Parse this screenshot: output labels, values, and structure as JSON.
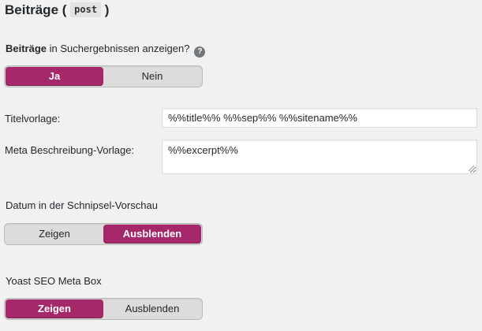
{
  "section": {
    "title": "Beiträge (",
    "code": "post",
    "title_end": ")"
  },
  "search_visibility": {
    "label_bold": "Beiträge",
    "label_rest": " in Suchergebnissen anzeigen?",
    "help_icon": "?",
    "options": [
      "Ja",
      "Nein"
    ],
    "selected": "Ja"
  },
  "title_template": {
    "label": "Titelvorlage:",
    "value": "%%title%% %%sep%% %%sitename%%"
  },
  "meta_description_template": {
    "label": "Meta Beschreibung-Vorlage:",
    "value": "%%excerpt%%"
  },
  "date_snippet": {
    "label": "Datum in der Schnipsel-Vorschau",
    "options": [
      "Zeigen",
      "Ausblenden"
    ],
    "selected": "Ausblenden"
  },
  "meta_box": {
    "label": "Yoast SEO Meta Box",
    "options": [
      "Zeigen",
      "Ausblenden"
    ],
    "selected": "Zeigen"
  },
  "colors": {
    "accent": "#a4286a",
    "background": "#f1f1f1",
    "switch_bg": "#dcdcdc"
  },
  "icons": {
    "help": "question-circle-icon",
    "resize": "resize-handle-icon"
  }
}
